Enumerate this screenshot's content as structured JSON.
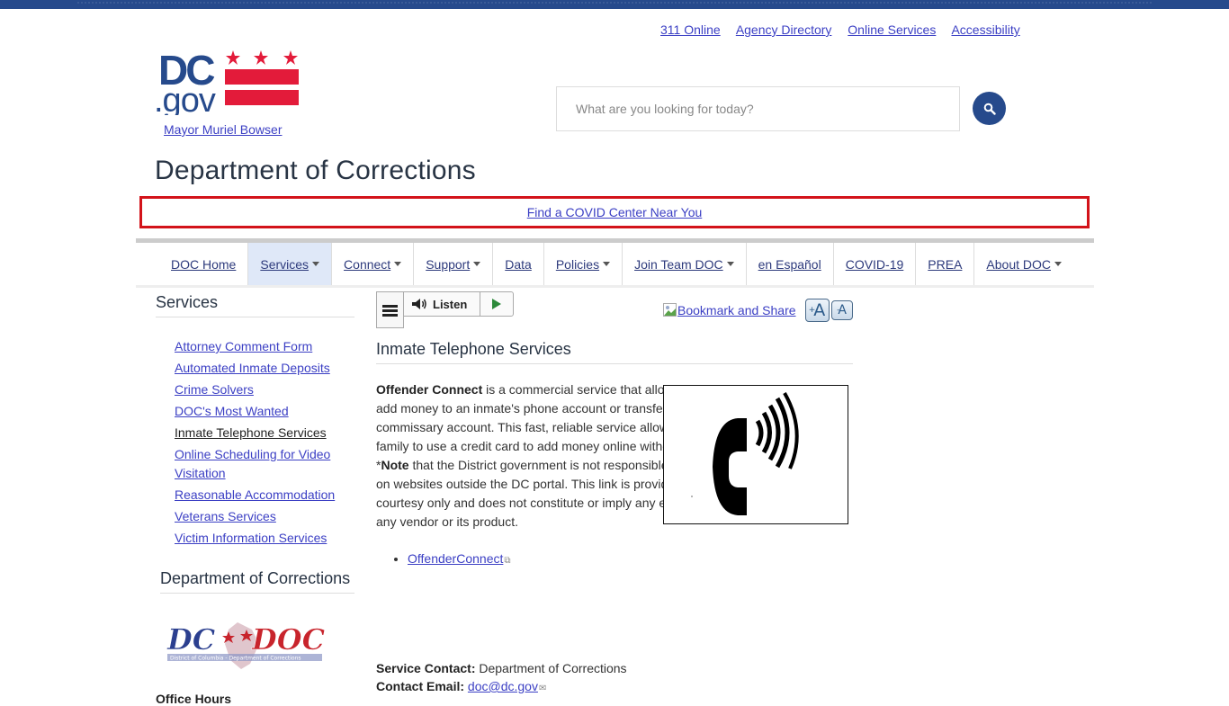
{
  "colors": {
    "brand_blue": "#264a8c",
    "brand_red": "#e31b3a",
    "link": "#3b3fc4",
    "alert_border": "#d3131a",
    "nav_active_bg": "#dfe8f8"
  },
  "utility_links": [
    "311 Online",
    "Agency Directory",
    "Online Services",
    "Accessibility"
  ],
  "logo": {
    "text_top": "DC",
    "text_bottom": ".gov",
    "alt": "DC.gov logo"
  },
  "mayor_link": "Mayor Muriel Bowser",
  "search": {
    "placeholder": "What are you looking for today?",
    "value": "",
    "button_icon": "search-icon"
  },
  "page_title": "Department of Corrections",
  "alert": {
    "link_text": "Find a COVID Center Near You"
  },
  "nav": {
    "items": [
      {
        "label": "DOC Home",
        "dropdown": false,
        "active": false
      },
      {
        "label": "Services",
        "dropdown": true,
        "active": true
      },
      {
        "label": "Connect",
        "dropdown": true,
        "active": false
      },
      {
        "label": "Support",
        "dropdown": true,
        "active": false
      },
      {
        "label": "Data",
        "dropdown": false,
        "active": false
      },
      {
        "label": "Policies",
        "dropdown": true,
        "active": false
      },
      {
        "label": "Join Team DOC",
        "dropdown": true,
        "active": false
      },
      {
        "label": "en Español",
        "dropdown": false,
        "active": false
      },
      {
        "label": "COVID-19",
        "dropdown": false,
        "active": false
      },
      {
        "label": "PREA",
        "dropdown": false,
        "active": false
      },
      {
        "label": "About DOC",
        "dropdown": true,
        "active": false
      }
    ]
  },
  "sidebar": {
    "heading": "Services",
    "items": [
      {
        "label": "Attorney Comment Form",
        "current": false
      },
      {
        "label": "Automated Inmate Deposits",
        "current": false
      },
      {
        "label": "Crime Solvers",
        "current": false
      },
      {
        "label": "DOC's Most Wanted",
        "current": false
      },
      {
        "label": "Inmate Telephone Services",
        "current": true
      },
      {
        "label": "Online Scheduling for Video Visitation",
        "current": false
      },
      {
        "label": "Reasonable Accommodation",
        "current": false
      },
      {
        "label": "Veterans Services",
        "current": false
      },
      {
        "label": "Victim Information Services",
        "current": false
      }
    ],
    "agency_heading": "Department of Corrections",
    "agency_logo": {
      "main": "DC DOC",
      "subtitle": "District of Columbia - Department of Corrections"
    },
    "office_hours_label": "Office Hours"
  },
  "toolbar": {
    "menu_icon": "hamburger-icon",
    "listen_label": "Listen",
    "bookmark_label": "Bookmark and Share",
    "font_increase": "A",
    "font_decrease": "A"
  },
  "content": {
    "title": "Inmate Telephone Services",
    "intro_bold": "Offender Connect",
    "intro_text": " is a commercial service that allows a user to add money to an inmate's phone account or transfer money to a commissary account. This fast, reliable service allows friends and family to use a credit card to add money online without calling ITI.  *",
    "note_bold": "Note",
    "note_text": " that the District government is not responsible for information on websites outside the DC portal. This link is provided as a courtesy only and does not constitute or imply any endorsement of any vendor or its product.",
    "image_alt": "telephone with sound waves icon",
    "links": [
      "OffenderConnect"
    ],
    "service_contact_label": "Service Contact:",
    "service_contact_value": " Department of Corrections",
    "contact_email_label": "Contact Email:",
    "contact_email_value": "doc@dc.gov"
  }
}
